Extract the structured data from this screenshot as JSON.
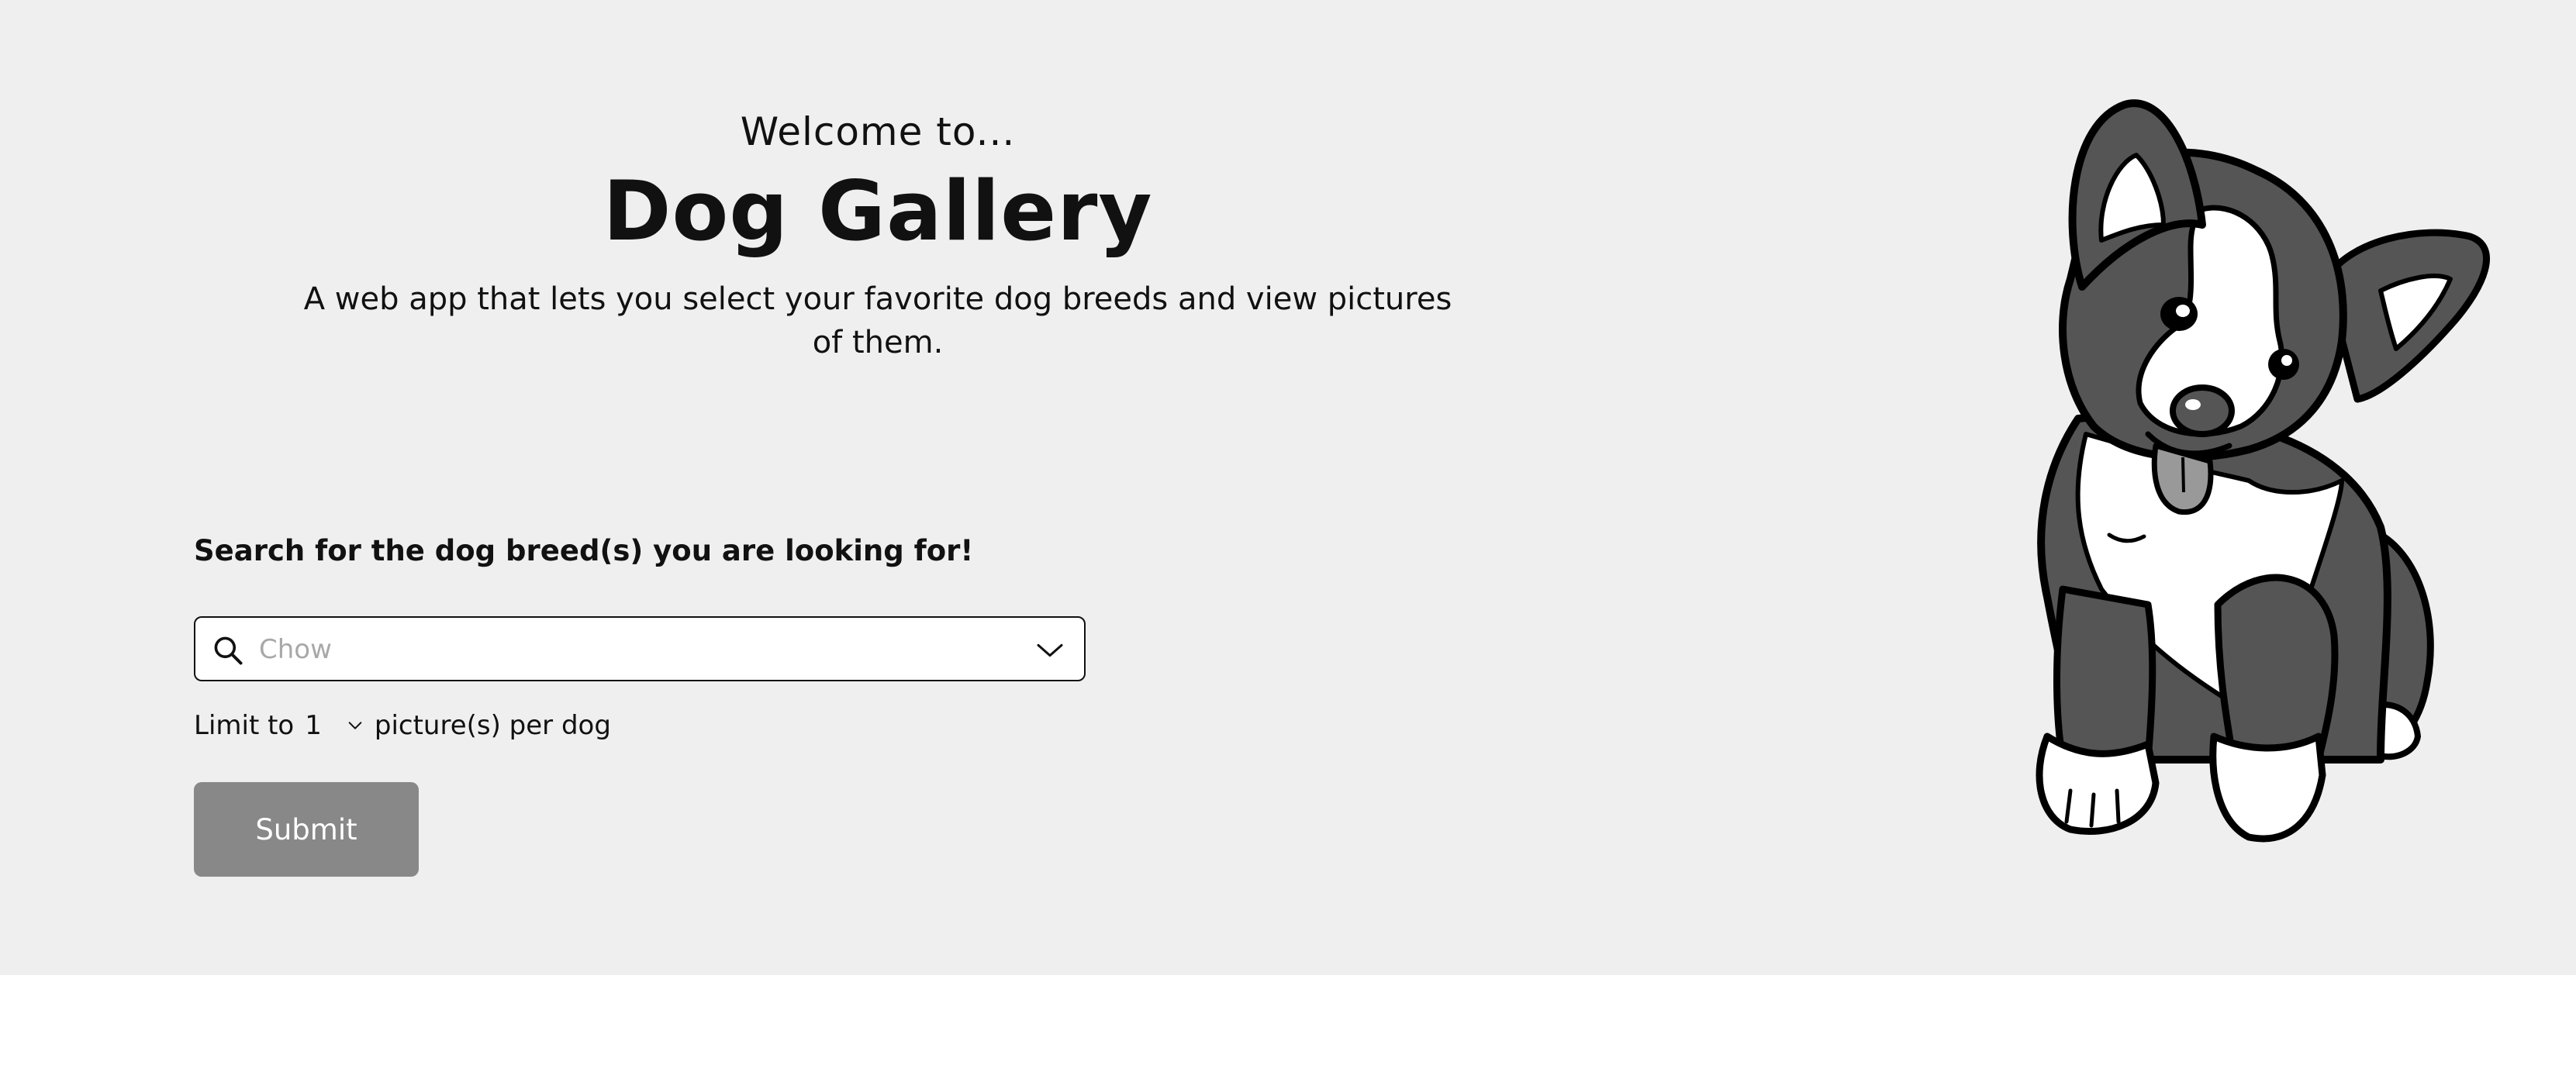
{
  "hero": {
    "welcome": "Welcome to...",
    "title": "Dog Gallery",
    "tagline": "A web app that lets you select your favorite dog breeds and view pictures of them."
  },
  "search": {
    "heading": "Search for the dog breed(s) you are looking for!",
    "placeholder": "Chow",
    "value": ""
  },
  "limit": {
    "prefix": "Limit to",
    "selected": "1",
    "suffix": "picture(s) per dog"
  },
  "submit_label": "Submit",
  "colors": {
    "hero_background": "#efefef",
    "submit_background": "#888888",
    "dog_fur_dark": "#555555"
  },
  "icons": {
    "search": "search-icon",
    "dropdown": "chevron-down-icon",
    "illustration": "dog-illustration"
  }
}
